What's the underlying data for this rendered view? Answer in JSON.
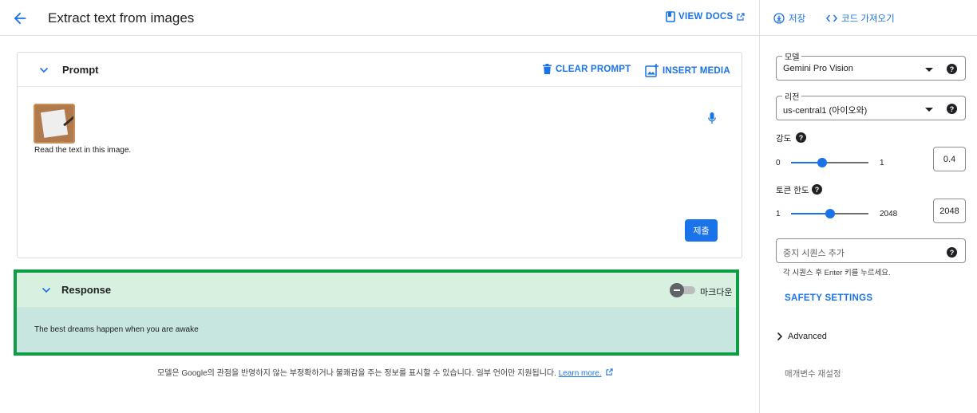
{
  "header": {
    "title": "Extract text from images",
    "view_docs_label": "VIEW DOCS"
  },
  "right_toolbar": {
    "save_label": "저장",
    "get_code_label": "코드 가져오기"
  },
  "prompt": {
    "section_title": "Prompt",
    "clear_label": "CLEAR PROMPT",
    "insert_media_label": "INSERT MEDIA",
    "text": "Read the text in this image.",
    "submit_label": "제출"
  },
  "response": {
    "section_title": "Response",
    "markdown_label": "마크다운",
    "text": "The best dreams happen when you are awake"
  },
  "disclaimer": {
    "text": "모델은 Google의 관점을 반영하지 않는 부정확하거나 불쾌감을 주는 정보를 표시할 수 있습니다. 일부 언어만 지원됩니다. ",
    "link_label": "Learn more."
  },
  "settings": {
    "model": {
      "label": "모델",
      "value": "Gemini Pro Vision"
    },
    "region": {
      "label": "리전",
      "value": "us-central1 (아이오와)"
    },
    "temperature": {
      "label": "강도",
      "min": "0",
      "max": "1",
      "value": "0.4",
      "fraction": 0.4
    },
    "token_limit": {
      "label": "토큰 한도",
      "min": "1",
      "max": "2048",
      "value": "2048",
      "fraction": 0.5
    },
    "stop_sequence": {
      "placeholder": "중지 시퀀스 추가",
      "hint": "각 시퀀스 후 Enter 키를 누르세요."
    },
    "safety_label": "SAFETY SETTINGS",
    "advanced_label": "Advanced",
    "reset_label": "매개변수 재설정"
  },
  "colors": {
    "accent": "#1a73e8",
    "highlight_border": "#0f9d44",
    "response_header_bg": "#d8f0e0",
    "response_body_bg": "#c7e6e0"
  }
}
